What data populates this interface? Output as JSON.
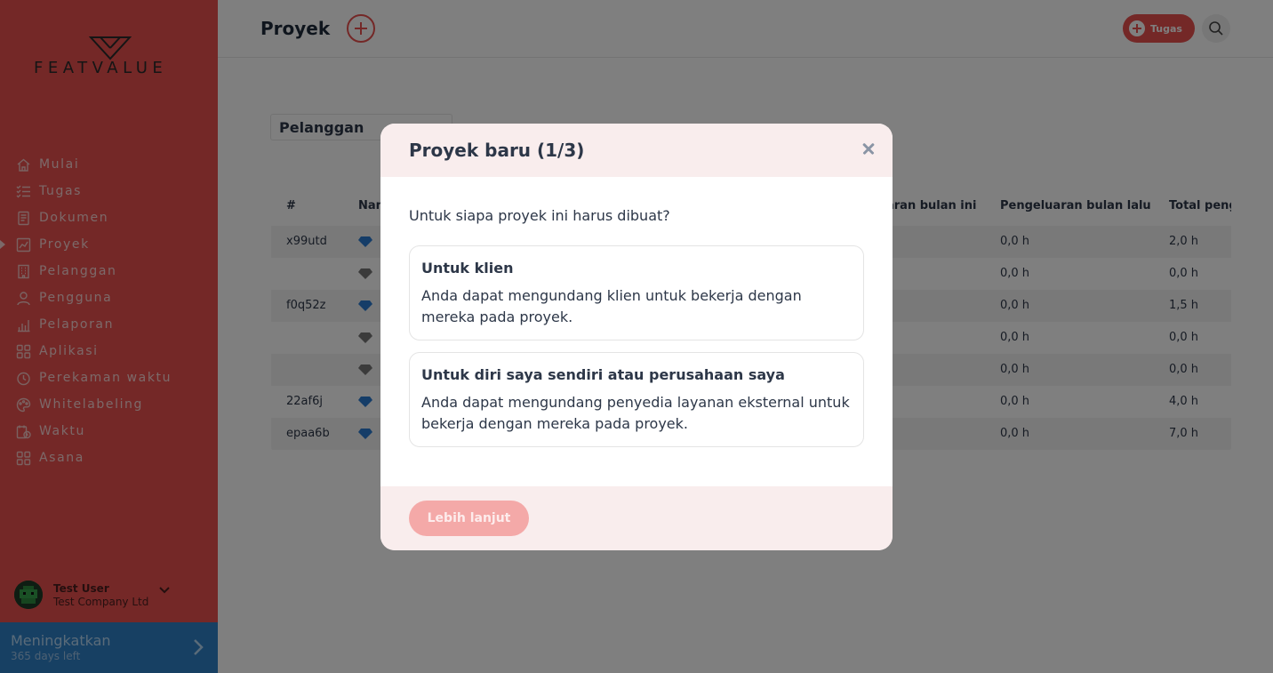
{
  "brand": {
    "logo_text": "FEATVALUE"
  },
  "sidebar": {
    "items": [
      {
        "label": "Mulai",
        "icon": "home-icon"
      },
      {
        "label": "Tugas",
        "icon": "checklist-icon"
      },
      {
        "label": "Dokumen",
        "icon": "document-icon"
      },
      {
        "label": "Proyek",
        "icon": "project-chart-icon",
        "active": true
      },
      {
        "label": "Pelanggan",
        "icon": "building-icon"
      },
      {
        "label": "Pengguna",
        "icon": "user-icon"
      },
      {
        "label": "Pelaporan",
        "icon": "bar-chart-icon"
      },
      {
        "label": "Aplikasi",
        "icon": "apps-icon"
      },
      {
        "label": "Perekaman waktu",
        "icon": "timer-icon"
      },
      {
        "label": "Whitelabeling",
        "icon": "palette-icon"
      },
      {
        "label": "Waktu",
        "icon": "calendar-clock-icon"
      },
      {
        "label": "Asana",
        "icon": "asana-icon"
      }
    ],
    "user": {
      "name": "Test User",
      "company": "Test Company Ltd"
    },
    "upgrade": {
      "title": "Meningkatkan",
      "subtitle": "365 days left"
    }
  },
  "header": {
    "title": "Proyek",
    "task_button_label": "Tugas"
  },
  "filter": {
    "label": "Pelanggan"
  },
  "table": {
    "columns": [
      "#",
      "Nam",
      "aran bulan ini",
      "Pengeluaran bulan lalu",
      "Total peng"
    ],
    "rows": [
      {
        "id": "x99utd",
        "gem": "blue",
        "last_month": "0,0 h",
        "total": "2,0 h"
      },
      {
        "id": "",
        "gem": "gray",
        "last_month": "0,0 h",
        "total": "0,0 h"
      },
      {
        "id": "f0q52z",
        "gem": "blue",
        "last_month": "0,0 h",
        "total": "1,5 h"
      },
      {
        "id": "",
        "gem": "gray",
        "last_month": "0,0 h",
        "total": "0,0 h"
      },
      {
        "id": "",
        "gem": "gray",
        "last_month": "0,0 h",
        "total": "0,0 h"
      },
      {
        "id": "22af6j",
        "gem": "blue",
        "last_month": "0,0 h",
        "total": "4,0 h"
      },
      {
        "id": "epaa6b",
        "gem": "blue",
        "last_month": "0,0 h",
        "total": "7,0 h"
      }
    ]
  },
  "modal": {
    "title": "Proyek baru (1/3)",
    "question": "Untuk siapa proyek ini harus dibuat?",
    "options": [
      {
        "title": "Untuk klien",
        "description": "Anda dapat mengundang klien untuk bekerja dengan mereka pada proyek."
      },
      {
        "title": "Untuk diri saya sendiri atau perusahaan saya",
        "description": "Anda dapat mengundang penyedia layanan eksternal untuk bekerja dengan mereka pada proyek."
      }
    ],
    "next_button_label": "Lebih lanjut"
  },
  "colors": {
    "sidebar": "#e8514f",
    "accent": "#e8514f",
    "upgrade": "#2f80c7",
    "modal_header": "#f9eded",
    "next_button_disabled": "#f4a9a8"
  }
}
